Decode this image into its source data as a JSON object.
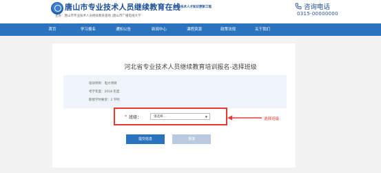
{
  "header": {
    "site_title": "唐山市专业技术人员继续教育在线",
    "slogan": "专业技术人才知识更新工程",
    "sponsor": "主办：唐山市专业技术人员继续教育基地 |唐山市广播电视大学",
    "hotline_label": "咨询电话",
    "hotline_number": "0315-00000000",
    "logo_icon": "university-logo",
    "phone_icon": "phone-icon"
  },
  "nav": {
    "items": [
      {
        "label": "首页"
      },
      {
        "label": "学习报名"
      },
      {
        "label": "通知公告"
      },
      {
        "label": "新闻中心"
      },
      {
        "label": "课程资源"
      },
      {
        "label": "政策法规"
      },
      {
        "label": "关于我们"
      }
    ]
  },
  "main": {
    "title": "河北省专业技术人员继续教育培训报名-选择班级",
    "info": {
      "project": "培训项目：电大项目",
      "year": "考学年度：2018 年度",
      "hours": "职授学时要求：2 学时"
    },
    "class_field": {
      "required_mark": "*",
      "label": "班级：",
      "placeholder": "请选择..."
    },
    "annotation": "选择班级",
    "buttons": {
      "submit": "提交信息",
      "reset": "重填"
    }
  },
  "colors": {
    "brand_blue": "#2a74bf",
    "highlight_red": "#e8382f",
    "info_bg": "#eef4fa"
  }
}
